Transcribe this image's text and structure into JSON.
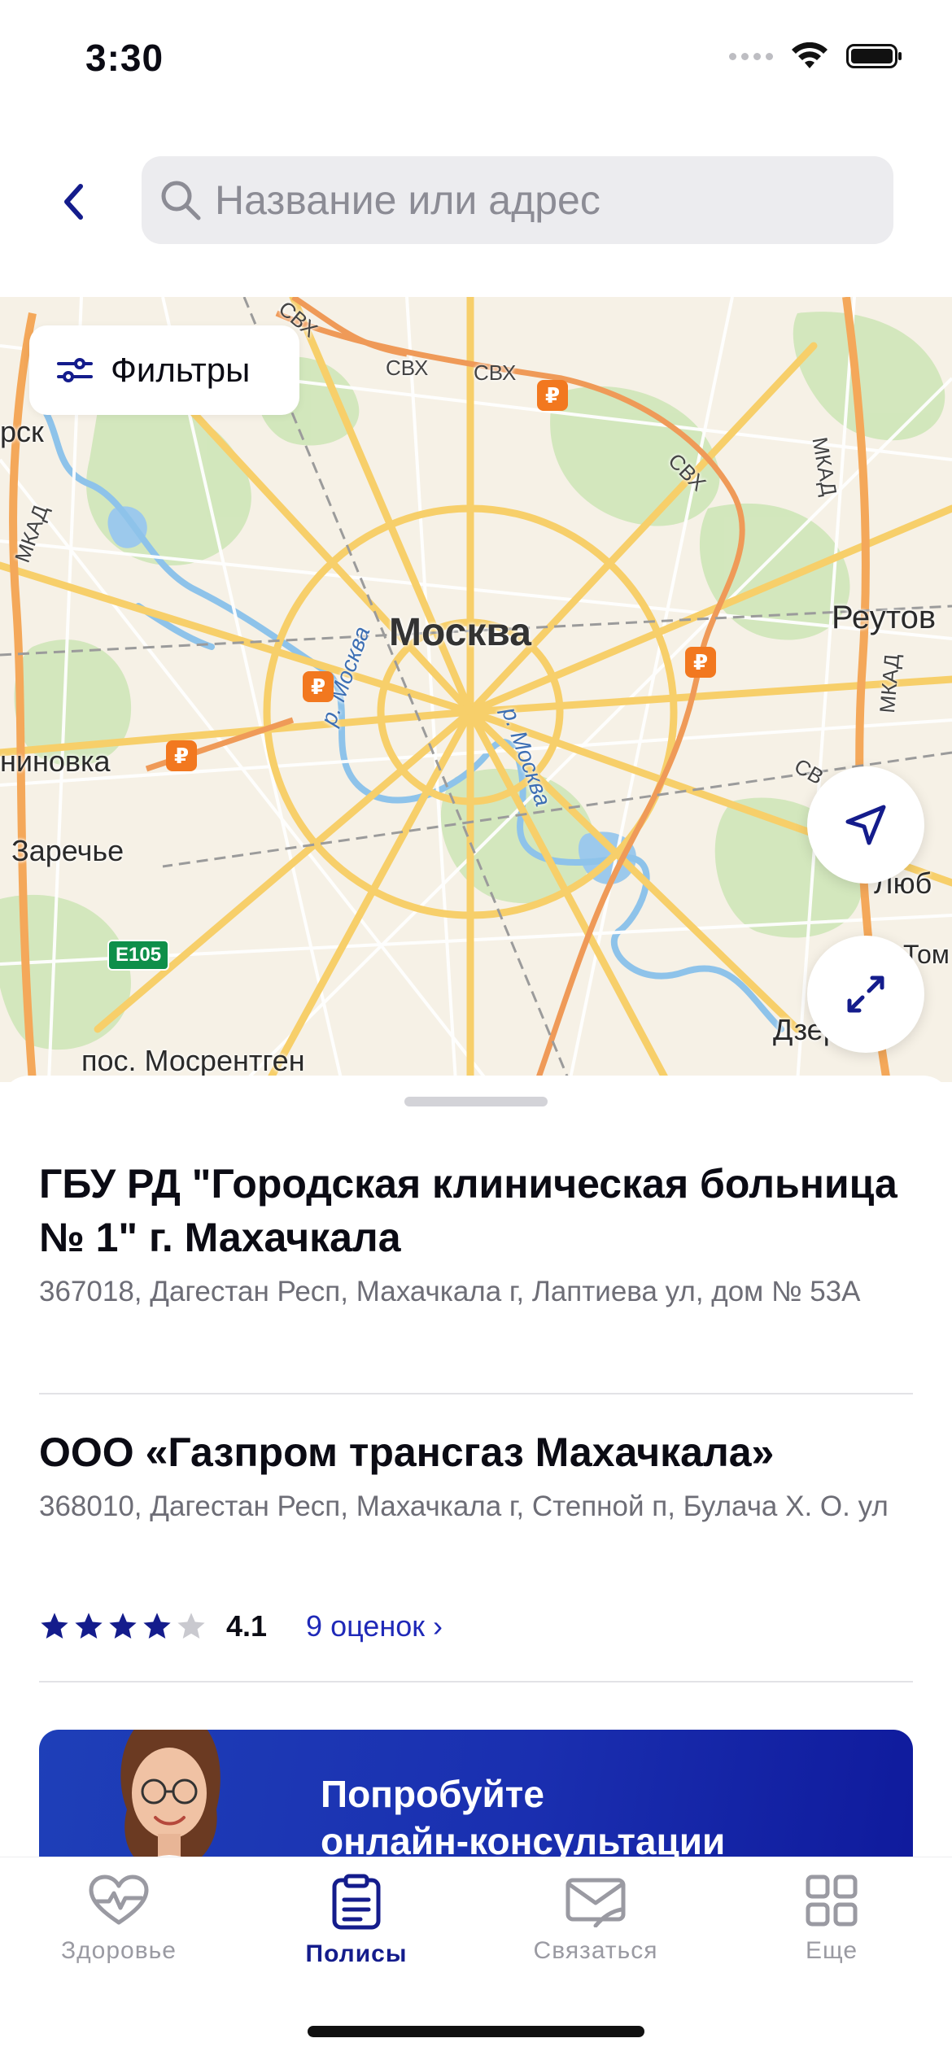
{
  "status_bar": {
    "time": "3:30",
    "icons": [
      "signal-icon",
      "wifi-icon",
      "battery-icon"
    ]
  },
  "header": {
    "back_icon": "chevron-left-icon",
    "search": {
      "placeholder": "Название или адрес",
      "value": "",
      "icon": "search-icon"
    }
  },
  "map": {
    "filters_label": "Фильтры",
    "labels": {
      "city": "Москва",
      "reutov": "Реутов",
      "zarechye": "Заречье",
      "ninovka": "ниновка",
      "rsk": "рск",
      "mosrentgen": "пос. Мосрентген",
      "lyub": "Люб",
      "dzer": "Дзер",
      "tom": "Том",
      "river1": "р. Москва",
      "river2": "р. Москва",
      "svh1": "СВХ",
      "svh2": "СВХ",
      "svh3": "СВХ",
      "svh4": "СВХ",
      "svh5": "СВ",
      "mkad1": "МКАД",
      "mkad2": "МКАД",
      "mkad3": "МКАД",
      "route": "E105",
      "metro": "₽"
    },
    "buttons": {
      "locate_icon": "navigation-arrow-icon",
      "expand_icon": "expand-icon"
    }
  },
  "organizations": [
    {
      "title": "ГБУ РД \"Городская клиническая больница № 1\" г. Махачкала",
      "address": "367018, Дагестан Респ, Махачкала г, Лаптиева ул, дом № 53А"
    },
    {
      "title": "ООО «Газпром трансгаз Махачкала»",
      "address": "368010, Дагестан Респ, Махачкала г, Степной п, Булача Х. О. ул",
      "rating": 4.1,
      "rating_text": "4.1",
      "reviews_label": "9 оценок ›"
    }
  ],
  "promo": {
    "line1": "Попробуйте",
    "line2": "онлайн-консультации"
  },
  "tab_bar": {
    "active": "Полисы",
    "items": [
      {
        "label": "Здоровье",
        "icon": "heart-pulse-icon"
      },
      {
        "label": "Полисы",
        "icon": "clipboard-icon"
      },
      {
        "label": "Связаться",
        "icon": "phone-mail-icon"
      },
      {
        "label": "Еще",
        "icon": "grid-icon"
      }
    ]
  },
  "colors": {
    "accent": "#141C8C",
    "link": "#1F29B8",
    "promo": "#1A2FB0",
    "metro": "#F2781F"
  }
}
